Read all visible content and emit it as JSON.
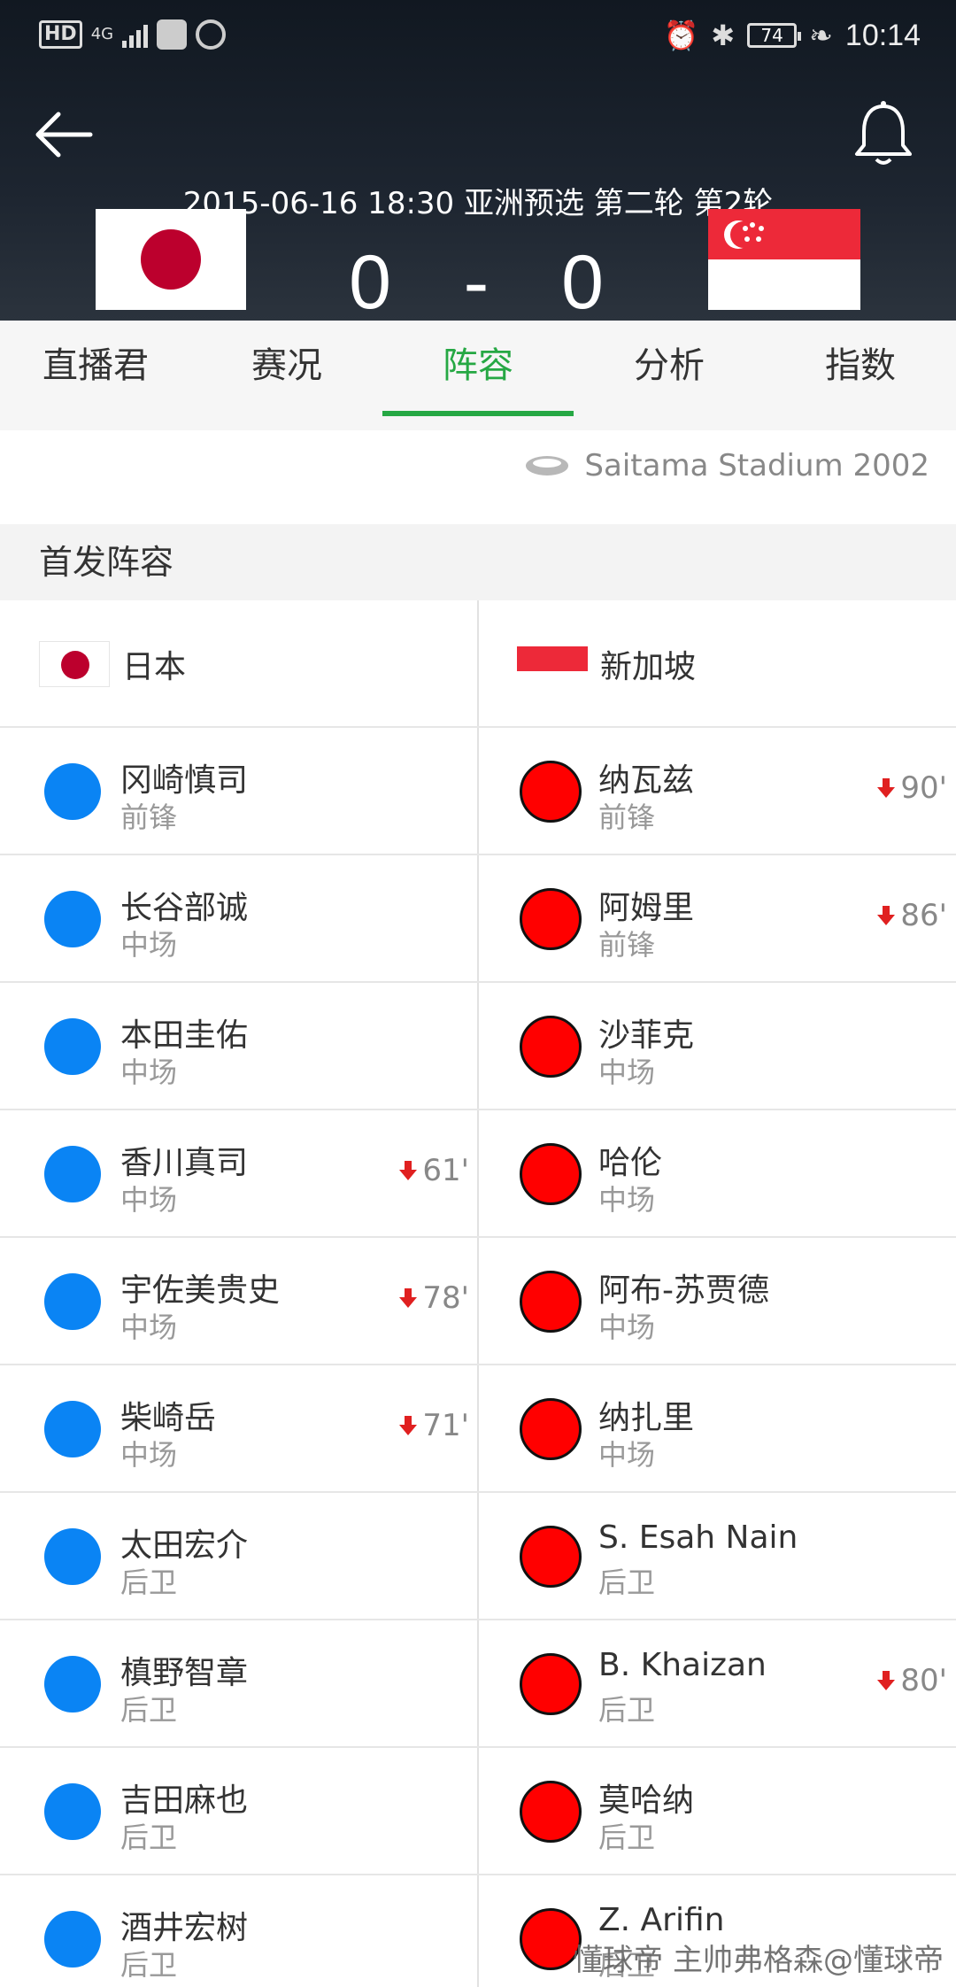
{
  "status_bar": {
    "network": "4G",
    "battery": "74",
    "time": "10:14"
  },
  "header": {
    "match_info": "2015-06-16 18:30 亚洲预选 第二轮 第2轮",
    "score_home": "0",
    "score_sep": "-",
    "score_away": "0",
    "home_flag_colors": [
      "#ffffff",
      "#bc002d"
    ],
    "away_flag_colors": [
      "#ed2939",
      "#ffffff"
    ]
  },
  "tabs": [
    "直播君",
    "赛况",
    "阵容",
    "分析",
    "指数"
  ],
  "active_tab": "阵容",
  "venue": "Saitama Stadium 2002",
  "section_title": "首发阵容",
  "teams": {
    "home": "日本",
    "away": "新加坡"
  },
  "lineup": [
    {
      "home": {
        "name": "冈崎慎司",
        "pos": "前锋",
        "sub": ""
      },
      "away": {
        "name": "纳瓦兹",
        "pos": "前锋",
        "sub": "90'"
      }
    },
    {
      "home": {
        "name": "长谷部诚",
        "pos": "中场",
        "sub": ""
      },
      "away": {
        "name": "阿姆里",
        "pos": "前锋",
        "sub": "86'"
      }
    },
    {
      "home": {
        "name": "本田圭佑",
        "pos": "中场",
        "sub": ""
      },
      "away": {
        "name": "沙菲克",
        "pos": "中场",
        "sub": ""
      }
    },
    {
      "home": {
        "name": "香川真司",
        "pos": "中场",
        "sub": "61'"
      },
      "away": {
        "name": "哈伦",
        "pos": "中场",
        "sub": ""
      }
    },
    {
      "home": {
        "name": "宇佐美贵史",
        "pos": "中场",
        "sub": "78'"
      },
      "away": {
        "name": "阿布-苏贾德",
        "pos": "中场",
        "sub": ""
      }
    },
    {
      "home": {
        "name": "柴崎岳",
        "pos": "中场",
        "sub": "71'"
      },
      "away": {
        "name": "纳扎里",
        "pos": "中场",
        "sub": ""
      }
    },
    {
      "home": {
        "name": "太田宏介",
        "pos": "后卫",
        "sub": ""
      },
      "away": {
        "name": "S. Esah Nain",
        "pos": "后卫",
        "sub": ""
      }
    },
    {
      "home": {
        "name": "槙野智章",
        "pos": "后卫",
        "sub": ""
      },
      "away": {
        "name": "B. Khaizan",
        "pos": "后卫",
        "sub": "80'"
      }
    },
    {
      "home": {
        "name": "吉田麻也",
        "pos": "后卫",
        "sub": ""
      },
      "away": {
        "name": "莫哈纳",
        "pos": "后卫",
        "sub": ""
      }
    },
    {
      "home": {
        "name": "酒井宏树",
        "pos": "后卫",
        "sub": ""
      },
      "away": {
        "name": "Z. Arifin",
        "pos": "后卫",
        "sub": ""
      }
    }
  ],
  "colors": {
    "home_dot": "#0a84f4",
    "away_dot": "#ff0000",
    "accent": "#26a844",
    "sub_arrow": "#e02020"
  },
  "watermark": "懂球帝 主帅弗格森@懂球帝"
}
